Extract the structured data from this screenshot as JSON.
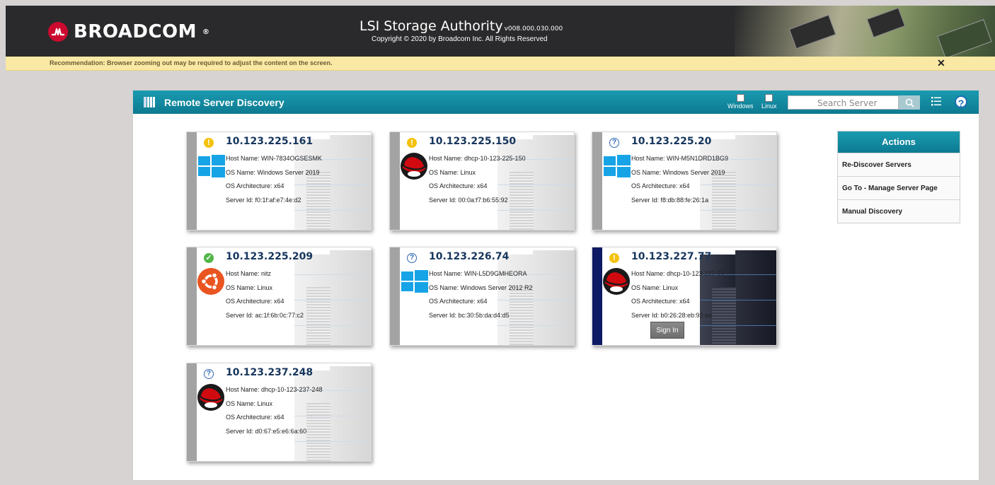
{
  "header": {
    "brand": "BROADCOM",
    "brand_mark": "®",
    "app_title": "LSI Storage Authority",
    "version": "v008.000.030.000",
    "copyright": "Copyright © 2020 by Broadcom Inc. All Rights Reserved"
  },
  "recommendation": {
    "message": "Recommendation: Browser zooming out may be required to adjust the content on the screen.",
    "close_label": "✕"
  },
  "panel": {
    "title": "Remote Server Discovery",
    "filters": [
      {
        "label": "Windows",
        "checked": false
      },
      {
        "label": "Linux",
        "checked": false
      }
    ],
    "search_placeholder": "Search Server"
  },
  "servers": [
    {
      "ip": "10.123.225.161",
      "status": "warning",
      "os": "windows",
      "host": "Host Name: WIN-7834OGSESMK",
      "os_name": "OS Name: Windows Server 2019",
      "arch": "OS Architecture: x64",
      "server_id": "Server Id: f0:1f:af:e7:4e:d2"
    },
    {
      "ip": "10.123.225.150",
      "status": "warning",
      "os": "redhat",
      "host": "Host Name: dhcp-10-123-225-150",
      "os_name": "OS Name: Linux",
      "arch": "OS Architecture: x64",
      "server_id": "Server Id: 00:0a:f7:b6:55:92"
    },
    {
      "ip": "10.123.225.20",
      "status": "unknown",
      "os": "windows",
      "host": "Host Name: WIN-M5N1DRD1BG9",
      "os_name": "OS Name: Windows Server 2019",
      "arch": "OS Architecture: x64",
      "server_id": "Server Id: f8:db:88:fe:26:1a"
    },
    {
      "ip": "10.123.225.209",
      "status": "ok",
      "os": "ubuntu",
      "host": "Host Name: nitz",
      "os_name": "OS Name: Linux",
      "arch": "OS Architecture: x64",
      "server_id": "Server Id: ac:1f:6b:0c:77:c2"
    },
    {
      "ip": "10.123.226.74",
      "status": "unknown",
      "os": "windows",
      "host": "Host Name: WIN-L5D9GMHEORA",
      "os_name": "OS Name: Windows Server 2012 R2",
      "arch": "OS Architecture: x64",
      "server_id": "Server Id: bc:30:5b:da:d4:d5"
    },
    {
      "ip": "10.123.227.77",
      "status": "warning",
      "os": "redhat",
      "host": "Host Name: dhcp-10-123-227-77",
      "os_name": "OS Name: Linux",
      "arch": "OS Architecture: x64",
      "server_id": "Server Id: b0:26:28:eb:92:ee",
      "sign_in_label": "Sign In"
    },
    {
      "ip": "10.123.237.248",
      "status": "unknown",
      "os": "redhat",
      "host": "Host Name: dhcp-10-123-237-248",
      "os_name": "OS Name: Linux",
      "arch": "OS Architecture: x64",
      "server_id": "Server Id: d0:67:e5:e6:6a:60"
    }
  ],
  "actions": {
    "title": "Actions",
    "items": [
      "Re-Discover Servers",
      "Go To - Manage Server Page",
      "Manual Discovery"
    ]
  },
  "colors": {
    "brand_red": "#cc092f",
    "teal_header": "#1a9bb0",
    "banner_yellow": "#fae9a4",
    "ip_blue": "#17365d",
    "active_strip": "#0e1a63"
  }
}
